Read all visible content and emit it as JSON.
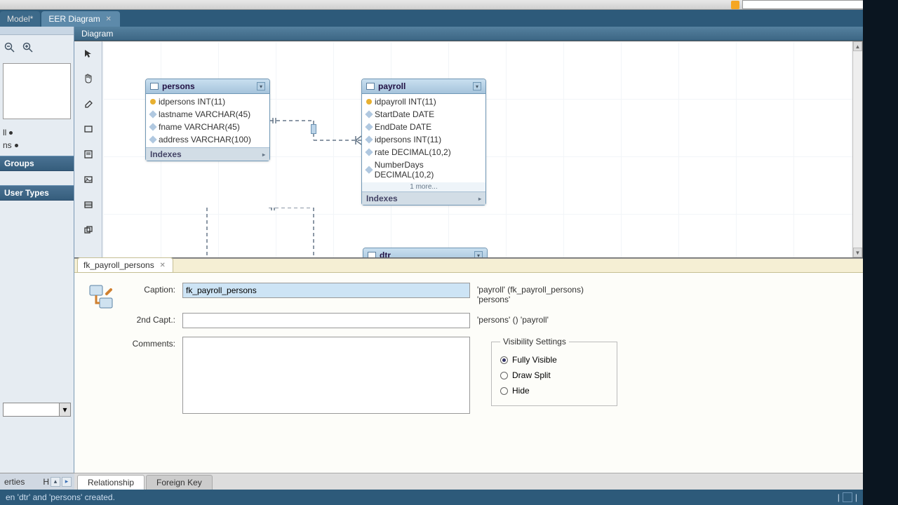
{
  "tabs": {
    "model": "Model*",
    "eer": "EER Diagram"
  },
  "diagram_header": "Diagram",
  "sidebar": {
    "tree": [
      "ll",
      "ns",
      ""
    ],
    "groups_label": "Groups",
    "usertypes_label": "User Types"
  },
  "entities": {
    "persons": {
      "name": "persons",
      "cols": [
        {
          "pk": true,
          "text": "idpersons INT(11)"
        },
        {
          "pk": false,
          "text": "lastname VARCHAR(45)"
        },
        {
          "pk": false,
          "text": "fname VARCHAR(45)"
        },
        {
          "pk": false,
          "text": "address VARCHAR(100)"
        }
      ],
      "indexes_label": "Indexes"
    },
    "payroll": {
      "name": "payroll",
      "cols": [
        {
          "pk": true,
          "text": "idpayroll INT(11)"
        },
        {
          "pk": false,
          "text": "StartDate DATE"
        },
        {
          "pk": false,
          "text": "EndDate DATE"
        },
        {
          "pk": false,
          "text": "idpersons INT(11)"
        },
        {
          "pk": false,
          "text": "rate DECIMAL(10,2)"
        },
        {
          "pk": false,
          "text": "NumberDays DECIMAL(10,2)"
        }
      ],
      "more_label": "1 more...",
      "indexes_label": "Indexes"
    },
    "partial": {
      "name": "dtr"
    }
  },
  "properties": {
    "tab_label": "fk_payroll_persons",
    "caption_label": "Caption:",
    "caption_value": "fk_payroll_persons",
    "caption_side": "'payroll' (fk_payroll_persons) 'persons'",
    "second_label": "2nd Capt.:",
    "second_value": "",
    "second_side": "'persons' () 'payroll'",
    "comments_label": "Comments:",
    "comments_value": "",
    "visibility": {
      "legend": "Visibility Settings",
      "options": [
        "Fully Visible",
        "Draw Split",
        "Hide"
      ],
      "selected": 0
    },
    "bottom_tabs": {
      "relationship": "Relationship",
      "foreignkey": "Foreign Key"
    }
  },
  "leftbottom_label": "erties",
  "status_text": "en 'dtr' and 'persons' created."
}
